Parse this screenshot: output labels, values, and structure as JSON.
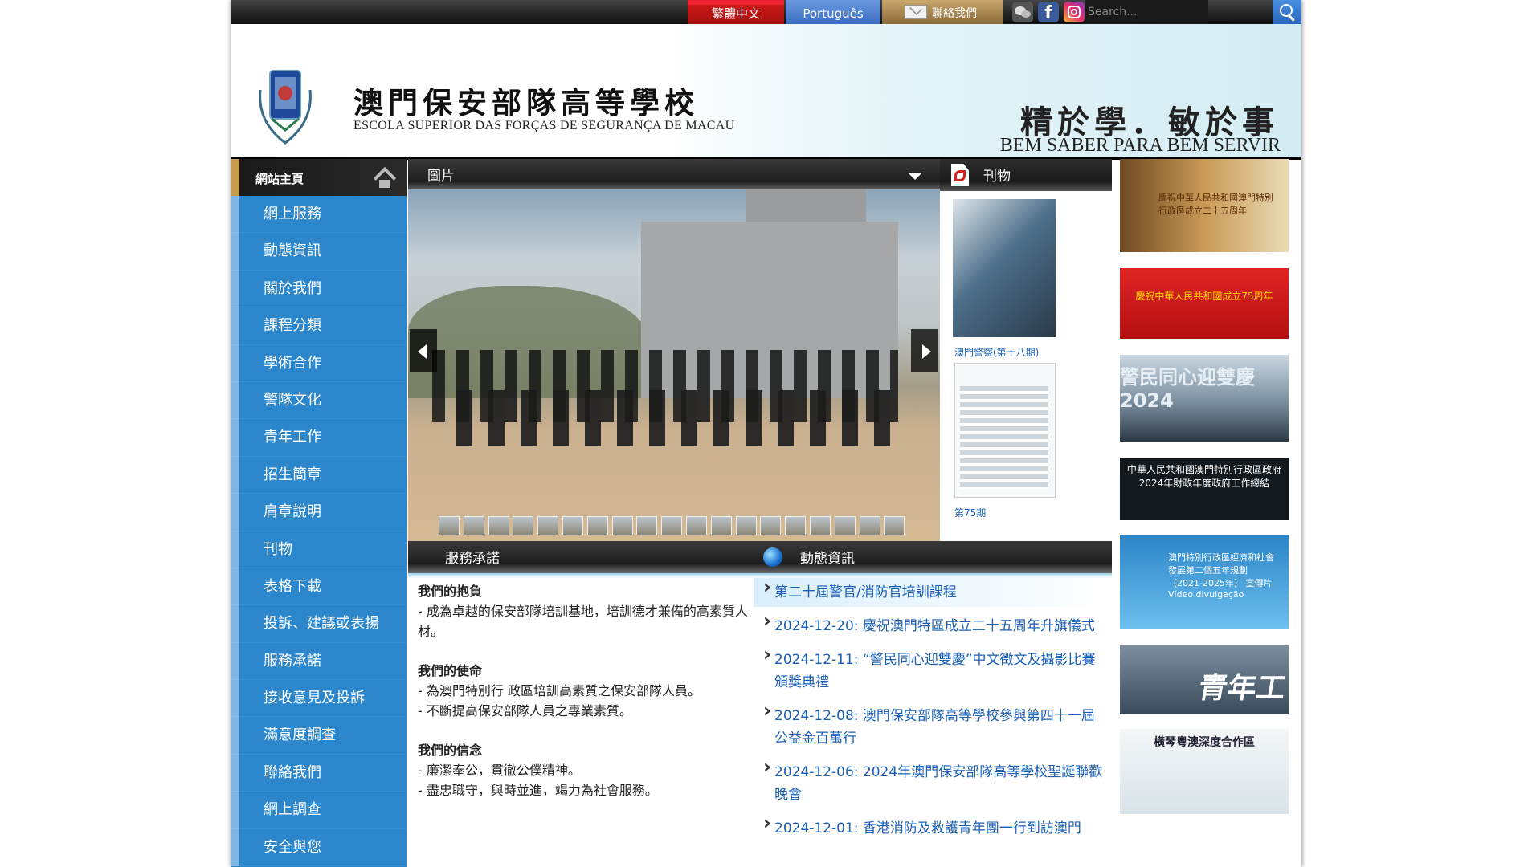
{
  "topbar": {
    "lang_zh": "繁體中文",
    "lang_pt": "Português",
    "contact": "聯絡我們",
    "search_placeholder": "Search..."
  },
  "header": {
    "title_zh": "澳門保安部隊高等學校",
    "title_pt": "ESCOLA SUPERIOR DAS FORÇAS DE SEGURANÇA DE MACAU",
    "motto_zh": "精於學．敏於事",
    "motto_pt": "BEM SABER PARA BEM SERVIR"
  },
  "sidebar": {
    "home": "網站主頁",
    "items": [
      "網上服務",
      "動態資訊",
      "關於我們",
      "課程分類",
      "學術合作",
      "警隊文化",
      "青年工作",
      "招生簡章",
      "肩章說明",
      "刊物",
      "表格下載",
      "投訴、建議或表揚",
      "服務承諾",
      "接收意見及投訴",
      "滿意度調查",
      "聯絡我們",
      "網上調查",
      "安全與您"
    ]
  },
  "photos": {
    "heading": "圖片"
  },
  "publications": {
    "heading": "刊物",
    "items": [
      {
        "label": "澳門警察(第十八期)"
      },
      {
        "label": "第75期"
      }
    ]
  },
  "banners": {
    "b1": "慶祝中華人民共和國澳門特別行政區成立二十五周年",
    "b2": "慶祝中華人民共和國成立75周年",
    "b3": "警民同心迎雙慶 2024",
    "b4": "中華人民共和國澳門特別行政區政府 2024年財政年度政府工作總結",
    "b5": "澳門特別行政區經濟和社會發展第二個五年規劃（2021-2025年） 宣傳片 Vídeo divulgação",
    "b6": "青年工作",
    "b7": "橫琴粵澳深度合作區"
  },
  "service": {
    "heading": "服務承諾",
    "sections": [
      {
        "title": "我們的抱負",
        "lines": [
          " - 成為卓越的保安部隊培訓基地，培訓德才兼備的高素質人材。"
        ]
      },
      {
        "title": "我們的使命",
        "lines": [
          " - 為澳門特別行 政區培訓高素質之保安部隊人員。",
          "- 不斷提高保安部隊人員之專業素質。"
        ]
      },
      {
        "title": "我們的信念",
        "lines": [
          " - 廉潔奉公，貫徹公僕精神。",
          "- 盡忠職守，與時並進，竭力為社會服務。"
        ]
      }
    ]
  },
  "news": {
    "heading": "動態資訊",
    "items": [
      "第二十屆警官/消防官培訓課程",
      "2024-12-20:  慶祝澳門特區成立二十五周年升旗儀式",
      "2024-12-11:    “警民同心迎雙慶”中文徵文及攝影比賽頒獎典禮",
      "2024-12-08:  澳門保安部隊高等學校參與第四十一屆公益金百萬行",
      "2024-12-06:  2024年澳門保安部隊高等學校聖誕聯歡晚會",
      "2024-12-01:  香港消防及救護青年團一行到訪澳門"
    ]
  }
}
